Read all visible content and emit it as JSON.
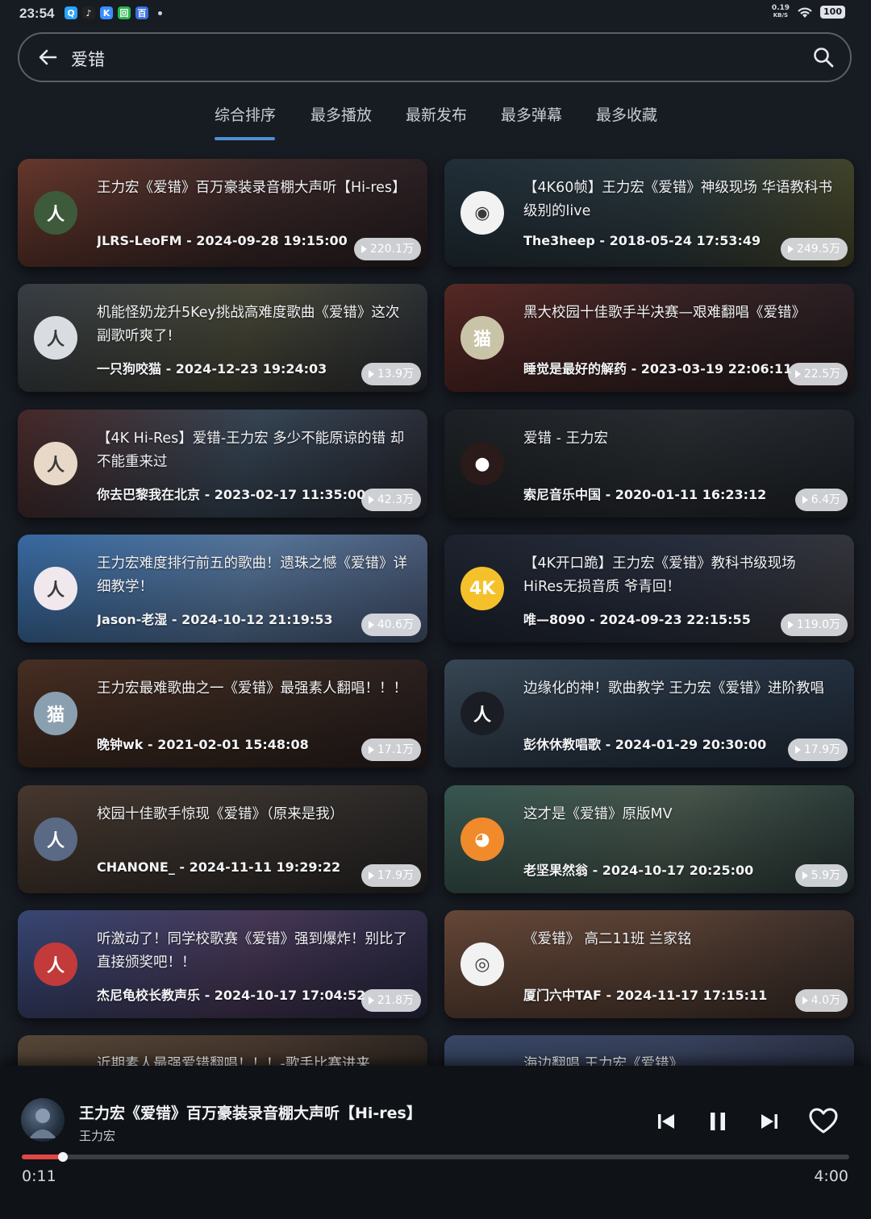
{
  "status_bar": {
    "time": "23:54",
    "speed_value": "0.19",
    "speed_unit": "KB/S",
    "battery": "100",
    "app_icons": [
      {
        "icon": "qq-icon",
        "glyph": "Q",
        "color": "#2aa4ff"
      },
      {
        "icon": "tiktok-icon",
        "glyph": "♪",
        "color": "#222222"
      },
      {
        "icon": "k-app-icon",
        "glyph": "K",
        "color": "#3b8cff"
      },
      {
        "icon": "green-app-icon",
        "glyph": "回",
        "color": "#27b34a"
      },
      {
        "icon": "blue-app-icon",
        "glyph": "百",
        "color": "#3a6fe0"
      }
    ]
  },
  "search": {
    "query": "爱错"
  },
  "tabs": [
    {
      "label": "综合排序",
      "active": true
    },
    {
      "label": "最多播放",
      "active": false
    },
    {
      "label": "最新发布",
      "active": false
    },
    {
      "label": "最多弹幕",
      "active": false
    },
    {
      "label": "最多收藏",
      "active": false
    }
  ],
  "results": [
    {
      "title": "王力宏《爱错》百万豪装录音棚大声听【Hi-res】",
      "meta": "JLRS-LeoFM - 2024-09-28 19:15:00",
      "views": "220.1万",
      "bg": [
        "#6b3a2e",
        "#3d2a2a",
        "#2a2024"
      ],
      "avatar_color": "#3d5a3a",
      "avatar_text": "人"
    },
    {
      "title": "【4K60帧】王力宏《爱错》神级现场 华语教科书级别的live",
      "meta": "The3heep - 2018-05-24 17:53:49",
      "views": "249.5万",
      "bg": [
        "#22303a",
        "#2c3a40",
        "#4a4a2a"
      ],
      "avatar_color": "#f2f2f2",
      "avatar_text": "◉"
    },
    {
      "title": "机能怪奶龙升5Key挑战高难度歌曲《爱错》这次副歌听爽了!",
      "meta": "一只狗咬猫 - 2024-12-23 19:24:03",
      "views": "13.9万",
      "bg": [
        "#3a4048",
        "#4a4a3a",
        "#2a2e36"
      ],
      "avatar_color": "#d9dde2",
      "avatar_text": "人"
    },
    {
      "title": "黑大校园十佳歌手半决赛—艰难翻唱《爱错》",
      "meta": "睡觉是最好的解药 - 2023-03-19 22:06:11",
      "views": "22.5万",
      "bg": [
        "#5a2a26",
        "#3a2426",
        "#2a2024"
      ],
      "avatar_color": "#c9c4a8",
      "avatar_text": "猫"
    },
    {
      "title": "【4K Hi-Res】爱错-王力宏 多少不能原谅的错 却不能重来过",
      "meta": "你去巴黎我在北京 - 2023-02-17 11:35:00",
      "views": "42.3万",
      "bg": [
        "#4a2a2a",
        "#384858",
        "#2a2a34"
      ],
      "avatar_color": "#e8d8c8",
      "avatar_text": "人"
    },
    {
      "title": "爱错 - 王力宏",
      "meta": "索尼音乐中国 - 2020-01-11 16:23:12",
      "views": "6.4万",
      "bg": [
        "#1e2226",
        "#2a2e32",
        "#20242a"
      ],
      "avatar_color": "#2a1a1a",
      "avatar_text": "●"
    },
    {
      "title": "王力宏难度排行前五的歌曲！遗珠之憾《爱错》详细教学！",
      "meta": "Jason-老湿 - 2024-10-12 21:19:53",
      "views": "40.6万",
      "bg": [
        "#3a6ea8",
        "#5a7aa0",
        "#4a5a78"
      ],
      "avatar_color": "#f0e8ec",
      "avatar_text": "人"
    },
    {
      "title": "【4K开口跪】王力宏《爱错》教科书级现场HiRes无损音质 爷青回！",
      "meta": "唯—8090 - 2024-09-23 22:15:55",
      "views": "119.0万",
      "bg": [
        "#1e2430",
        "#2a3040",
        "#3a3a40"
      ],
      "avatar_color": "#f5c12a",
      "avatar_text": "4K"
    },
    {
      "title": "王力宏最难歌曲之一《爱错》最强素人翻唱！！！",
      "meta": "晚钟wk - 2021-02-01 15:48:08",
      "views": "17.1万",
      "bg": [
        "#4a3024",
        "#3a2a22",
        "#2a2020"
      ],
      "avatar_color": "#8aa0b0",
      "avatar_text": "猫"
    },
    {
      "title": "边缘化的神！歌曲教学 王力宏《爱错》进阶教唱",
      "meta": "彭休休教唱歌 - 2024-01-29 20:30:00",
      "views": "17.9万",
      "bg": [
        "#3a4a58",
        "#2a3848",
        "#243040"
      ],
      "avatar_color": "#1a1e24",
      "avatar_text": "人"
    },
    {
      "title": "校园十佳歌手惊现《爱错》（原来是我）",
      "meta": "CHANONE_ - 2024-11-11 19:29:22",
      "views": "17.9万",
      "bg": [
        "#4a3a30",
        "#3a3430",
        "#2a2828"
      ],
      "avatar_color": "#5a6a84",
      "avatar_text": "人"
    },
    {
      "title": "这才是《爱错》原版MV",
      "meta": "老坚果然翁 - 2024-10-17 20:25:00",
      "views": "5.9万",
      "bg": [
        "#3a5a54",
        "#4a5a50",
        "#2a3a38"
      ],
      "avatar_color": "#f08a2a",
      "avatar_text": "◕"
    },
    {
      "title": "听激动了！同学校歌赛《爱错》强到爆炸！别比了直接颁奖吧！！",
      "meta": "杰尼龟校长教声乐 - 2024-10-17 17:04:52",
      "views": "21.8万",
      "bg": [
        "#3a4a7a",
        "#4a3a5a",
        "#2a2a44"
      ],
      "avatar_color": "#c23a3a",
      "avatar_text": "人"
    },
    {
      "title": "《爱错》 高二11班 兰家铭",
      "meta": "厦门六中TAF - 2024-11-17 17:15:11",
      "views": "4.0万",
      "bg": [
        "#6a4a3a",
        "#5a4236",
        "#3a2e2a"
      ],
      "avatar_color": "#f2f2f2",
      "avatar_text": "◎"
    },
    {
      "title": "近期素人最强爱错翻唱！！！-歌手比赛进来",
      "meta": "",
      "views": "",
      "bg": [
        "#5a4a3a",
        "#4a3a30",
        "#2a2420"
      ],
      "avatar_color": "#444444",
      "avatar_text": ""
    },
    {
      "title": "海边翻唱 王力宏《爱错》",
      "meta": "",
      "views": "",
      "bg": [
        "#3a4a6a",
        "#3a4460",
        "#2a3044"
      ],
      "avatar_color": "#444444",
      "avatar_text": ""
    }
  ],
  "player": {
    "title": "王力宏《爱错》百万豪装录音棚大声听【Hi-res】",
    "artist": "王力宏",
    "current_time": "0:11",
    "duration": "4:00",
    "progress": 0.05,
    "icons": [
      "previous-icon",
      "pause-icon",
      "next-icon",
      "heart-icon"
    ],
    "accent": "#e04646"
  }
}
